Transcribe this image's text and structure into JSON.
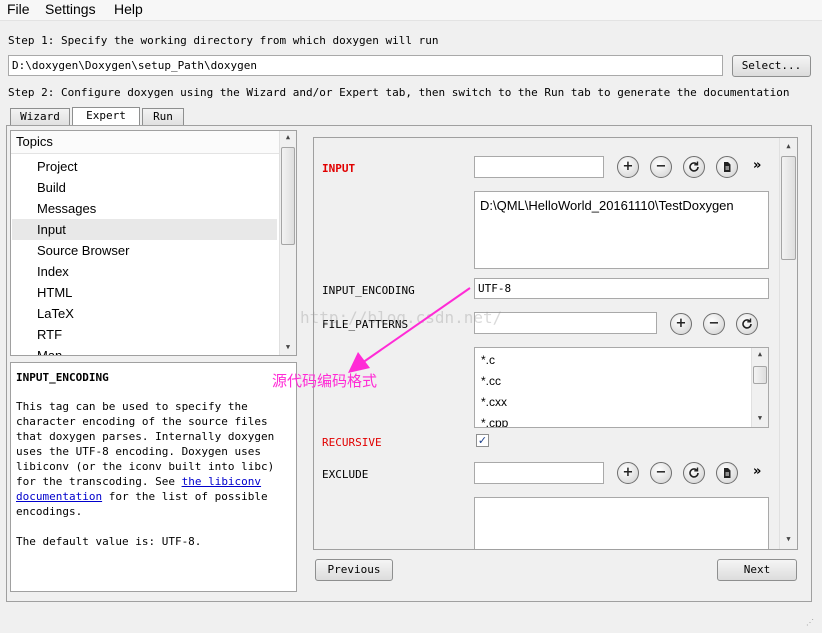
{
  "menu": [
    "File",
    "Settings",
    "Help"
  ],
  "step1": {
    "text": "Step 1: Specify the working directory from which doxygen will run",
    "path": "D:\\doxygen\\Doxygen\\setup_Path\\doxygen",
    "select_label": "Select..."
  },
  "step2": {
    "text": "Step 2: Configure doxygen using the Wizard and/or Expert tab, then switch to the Run tab to generate the documentation"
  },
  "tabs": [
    "Wizard",
    "Expert",
    "Run"
  ],
  "topics": {
    "header": "Topics",
    "items": [
      "Project",
      "Build",
      "Messages",
      "Input",
      "Source Browser",
      "Index",
      "HTML",
      "LaTeX",
      "RTF",
      "Man"
    ],
    "selected": "Input"
  },
  "help": {
    "title": "INPUT_ENCODING",
    "para_before_link": "This tag can be used to specify the\ncharacter encoding of the source files\nthat doxygen parses. Internally doxygen\nuses the UTF-8 encoding. Doxygen uses\nlibiconv (or the iconv built into libc)\nfor the transcoding. See ",
    "link_line1": "the libiconv",
    "link_line2": "documentation",
    "para_after_link": " for the list of possible\nencodings.",
    "default_text": "The default value is: UTF-8."
  },
  "settings": {
    "input_label": "INPUT",
    "input_value": "",
    "input_list": [
      "D:\\QML\\HelloWorld_20161110\\TestDoxygen"
    ],
    "encoding_label": "INPUT_ENCODING",
    "encoding_value": "UTF-8",
    "patterns_label": "FILE_PATTERNS",
    "patterns_value": "",
    "patterns_list": [
      "*.c",
      "*.cc",
      "*.cxx",
      "*.cpp"
    ],
    "recursive_label": "RECURSIVE",
    "recursive_checked": true,
    "exclude_label": "EXCLUDE",
    "exclude_value": ""
  },
  "annotation": {
    "text": "源代码编码格式",
    "color": "#ff2bd6"
  },
  "watermark": "http://blog.csdn.net/",
  "nav": {
    "previous_label": "Previous",
    "next_label": "Next"
  },
  "colors": {
    "required_label": "#e10000",
    "link": "#0000cc",
    "selected_row": "#e8e8e8"
  }
}
